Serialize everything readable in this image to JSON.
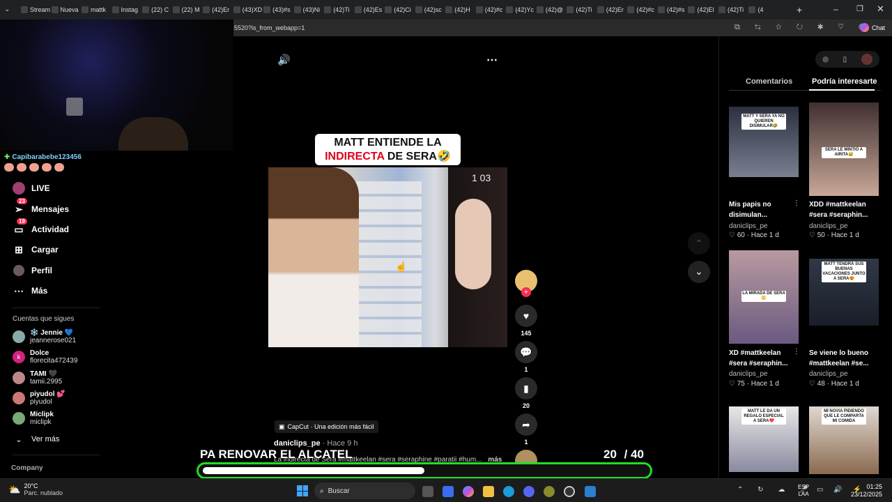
{
  "browser": {
    "tabs": [
      "Stream",
      "Nueva",
      "mattk",
      "Instag",
      "(22) C",
      "(22) M",
      "(42)Er",
      "(43)XD",
      "(43)#s",
      "(43)Ni",
      "(42)Ti",
      "(42)Es",
      "(42)Ci",
      "(42)sc",
      "(42)H",
      "(42)#c",
      "(42)Yc",
      "(42)@",
      "(42)Ti",
      "(42)Er",
      "(42)#c",
      "(42)#s",
      "(42)El",
      "(42)Ti",
      "(4"
    ],
    "url": "5520?is_from_webapp=1",
    "chat_label": "Chat"
  },
  "stream": {
    "viewer_name": "Capibarabebe123456"
  },
  "sidebar": {
    "items": [
      {
        "label": "LIVE",
        "icon": "live-icon"
      },
      {
        "label": "Mensajes",
        "icon": "messages-icon",
        "badge": "23"
      },
      {
        "label": "Actividad",
        "icon": "activity-icon",
        "badge": "19"
      },
      {
        "label": "Cargar",
        "icon": "upload-icon"
      },
      {
        "label": "Perfil",
        "icon": "profile-icon"
      },
      {
        "label": "Más",
        "icon": "more-icon"
      }
    ],
    "following_title": "Cuentas que sigues",
    "following": [
      {
        "name": "❄️ Jennie 💙",
        "user": "jeannerose021",
        "color": "#8aa"
      },
      {
        "name": "Dolce",
        "user": "florecita472439",
        "color": "#d0237f"
      },
      {
        "name": "TAMI 🖤",
        "user": "tamii.2995",
        "color": "#b88"
      },
      {
        "name": "piyudol 💕",
        "user": "piyudol",
        "color": "#c77"
      },
      {
        "name": "Miclipk",
        "user": "miclipk",
        "color": "#7a7"
      }
    ],
    "see_more": "Ver más",
    "company": "Company"
  },
  "video": {
    "title_line1": "MATT ENTIENDE LA",
    "title_red": "INDIRECTA",
    "title_line2": " DE SERA🤣",
    "timer": "1  03",
    "capcut": "CapCut · Una edición más fácil",
    "author": "daniclips_pe",
    "time": " · Hace 9 h",
    "description": "La indirecta de Sera #mattkeelan #sera #seraphine #paratii #hum...",
    "more": "más",
    "counts": {
      "likes": "145",
      "comments": "1",
      "saves": "20",
      "shares": "1"
    }
  },
  "overlay": {
    "goal_text": "PA RENOVAR EL ALCATEL",
    "goal_current": "20",
    "goal_total": "/ 40",
    "progress": 0.5
  },
  "right_panel": {
    "tab_comments": "Comentarios",
    "tab_interest": "Podría interesarte",
    "videos": [
      {
        "caption": "Mis papis no disimulan...",
        "author": "daniclips_pe",
        "likes": "60",
        "time": "Hace 1 d",
        "badge": "MATT Y SERA YA NO QUIEREN DISIMULAR🤣"
      },
      {
        "caption": "XDD #mattkeelan #sera #seraphin...",
        "author": "daniclips_pe",
        "likes": "50",
        "time": "Hace 1 d",
        "badge": "SERA LE MINTIÓ A AIRITA😅"
      },
      {
        "caption": "XD #mattkeelan #sera #seraphin...",
        "author": "daniclips_pe",
        "likes": "75",
        "time": "Hace 1 d",
        "badge": "LA MIRADA DE SERA😳"
      },
      {
        "caption": "Se viene lo bueno #mattkeelan #se...",
        "author": "daniclips_pe",
        "likes": "48",
        "time": "Hace 1 d",
        "badge": "MATT TENDRÁ SUS BUENAS VACACIONES JUNTO A SERA😍"
      },
      {
        "badge": "MATT LE DA UN REGALO ESPECIAL A SERA❤️"
      },
      {
        "badge": "MI NOVIA PIDIENDO QUE LE COMPARTA MI COMIDA"
      }
    ]
  },
  "taskbar": {
    "weather_temp": "20°C",
    "weather_desc": "Parc. nublado",
    "search_placeholder": "Buscar",
    "lang1": "ESP",
    "lang2": "LAA",
    "time": "01:25",
    "date": "23/12/2025"
  }
}
